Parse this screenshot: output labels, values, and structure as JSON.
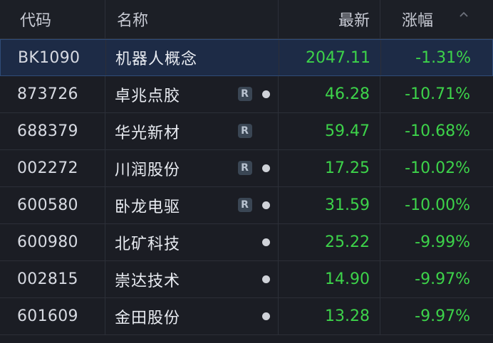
{
  "header": {
    "code": "代码",
    "name": "名称",
    "price": "最新",
    "change": "涨幅"
  },
  "rows": [
    {
      "code": "BK1090",
      "name": "机器人概念",
      "price": "2047.11",
      "change": "-1.31%",
      "badge": "",
      "dot": false
    },
    {
      "code": "873726",
      "name": "卓兆点胶",
      "price": "46.28",
      "change": "-10.71%",
      "badge": "R",
      "dot": true
    },
    {
      "code": "688379",
      "name": "华光新材",
      "price": "59.47",
      "change": "-10.68%",
      "badge": "R",
      "dot": false
    },
    {
      "code": "002272",
      "name": "川润股份",
      "price": "17.25",
      "change": "-10.02%",
      "badge": "R",
      "dot": true
    },
    {
      "code": "600580",
      "name": "卧龙电驱",
      "price": "31.59",
      "change": "-10.00%",
      "badge": "R",
      "dot": true
    },
    {
      "code": "600980",
      "name": "北矿科技",
      "price": "25.22",
      "change": "-9.99%",
      "badge": "",
      "dot": true
    },
    {
      "code": "002815",
      "name": "崇达技术",
      "price": "14.90",
      "change": "-9.97%",
      "badge": "",
      "dot": true
    },
    {
      "code": "601609",
      "name": "金田股份",
      "price": "13.28",
      "change": "-9.97%",
      "badge": "",
      "dot": true
    }
  ],
  "colors": {
    "down": "#3dd34a",
    "selected_bg": "#1d2b46",
    "background": "#1b1d24"
  },
  "icons": {
    "sort": "chevron-up-icon",
    "badge": "r-badge-icon",
    "dot": "status-dot-icon"
  }
}
